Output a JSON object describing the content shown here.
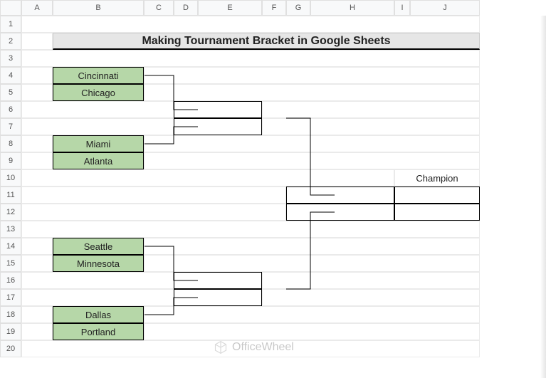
{
  "columns": [
    "A",
    "B",
    "C",
    "D",
    "E",
    "F",
    "G",
    "H",
    "I",
    "J"
  ],
  "rows": [
    "1",
    "2",
    "3",
    "4",
    "5",
    "6",
    "7",
    "8",
    "9",
    "10",
    "11",
    "12",
    "13",
    "14",
    "15",
    "16",
    "17",
    "18",
    "19",
    "20"
  ],
  "title": "Making Tournament Bracket in Google Sheets",
  "teams": {
    "r1a": "Cincinnati",
    "r1b": "Chicago",
    "r2a": "Miami",
    "r2b": "Atlanta",
    "r3a": "Seattle",
    "r3b": "Minnesota",
    "r4a": "Dallas",
    "r4b": "Portland"
  },
  "champion_label": "Champion",
  "watermark": "OfficeWheel",
  "chart_data": {
    "type": "table",
    "title": "Making Tournament Bracket in Google Sheets",
    "round1_matchups": [
      [
        "Cincinnati",
        "Chicago"
      ],
      [
        "Miami",
        "Atlanta"
      ],
      [
        "Seattle",
        "Minnesota"
      ],
      [
        "Dallas",
        "Portland"
      ]
    ],
    "round2_slots": 2,
    "final_slot": 1,
    "champion_slot": 1
  }
}
